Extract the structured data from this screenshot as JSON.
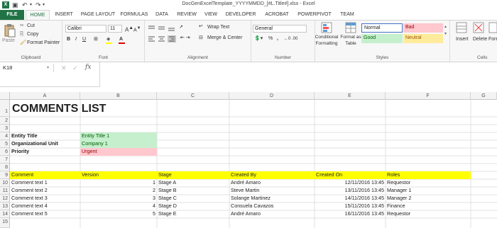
{
  "window": {
    "title": "DocGenExcelTemplate_YYYYMMDD_[#L.Title#].xlsx - Excel"
  },
  "tabs": [
    "FILE",
    "HOME",
    "INSERT",
    "PAGE LAYOUT",
    "FORMULAS",
    "DATA",
    "REVIEW",
    "VIEW",
    "DEVELOPER",
    "ACROBAT",
    "POWERPIVOT",
    "TEAM"
  ],
  "ribbon": {
    "clipboard": {
      "paste": "Paste",
      "cut": "Cut",
      "copy": "Copy",
      "format_painter": "Format Painter",
      "label": "Clipboard"
    },
    "font": {
      "name": "Calibri",
      "size": "11",
      "label": "Font"
    },
    "alignment": {
      "wrap": "Wrap Text",
      "merge": "Merge & Center",
      "label": "Alignment"
    },
    "number": {
      "format": "General",
      "percent": "%",
      "comma": ",",
      "label": "Number"
    },
    "styles": {
      "conditional": "Conditional Formatting",
      "format_table": "Format as Table",
      "normal": "Normal",
      "bad": "Bad",
      "good": "Good",
      "neutral": "Neutral",
      "label": "Styles"
    },
    "cells": {
      "insert": "Insert",
      "delete": "Delete",
      "format": "Forma",
      "label": "Cells"
    }
  },
  "formula_bar": {
    "name_box": "K18",
    "fx": "fx",
    "value": ""
  },
  "columns": [
    "A",
    "B",
    "C",
    "D",
    "E",
    "F",
    "G"
  ],
  "rows": [
    "1",
    "2",
    "3",
    "4",
    "5",
    "6",
    "7",
    "8",
    "9",
    "10",
    "11",
    "12",
    "13",
    "14",
    "15"
  ],
  "sheet": {
    "title": "COMMENTS LIST",
    "fields": [
      {
        "label": "Entity Title",
        "value": "Entity Title 1"
      },
      {
        "label": "Organizational Unit",
        "value": "Company 1"
      },
      {
        "label": "Priority",
        "value": "Urgent"
      }
    ],
    "headers": [
      "Comment",
      "Version",
      "Stage",
      "Created By",
      "Created On",
      "Roles"
    ],
    "data": [
      [
        "Comment text 1",
        "1",
        "Stage A",
        "André Amaro",
        "12/11/2016 13:45",
        "Requestor"
      ],
      [
        "Comment text 2",
        "2",
        "Stage B",
        "Steve Martin",
        "13/11/2016 13:45",
        "Manager 1"
      ],
      [
        "Comment text 3",
        "3",
        "Stage C",
        "Solange Martinez",
        "14/11/2016 13:45",
        "Manager 2"
      ],
      [
        "Comment text 4",
        "4",
        "Stage D",
        "Consuela Cavazos",
        "15/11/2016 13:45",
        "Finance"
      ],
      [
        "Comment text 5",
        "5",
        "Stage E",
        "André Amaro",
        "16/11/2016 13:45",
        "Requestor"
      ]
    ]
  },
  "colors": {
    "accent": "#217346",
    "header_yellow": "#ffff00",
    "good_fill": "#c6efce",
    "good_text": "#006100",
    "bad_fill": "#ffc7ce",
    "bad_text": "#9c0006",
    "neutral_fill": "#ffeb9c",
    "neutral_text": "#9c5700"
  }
}
